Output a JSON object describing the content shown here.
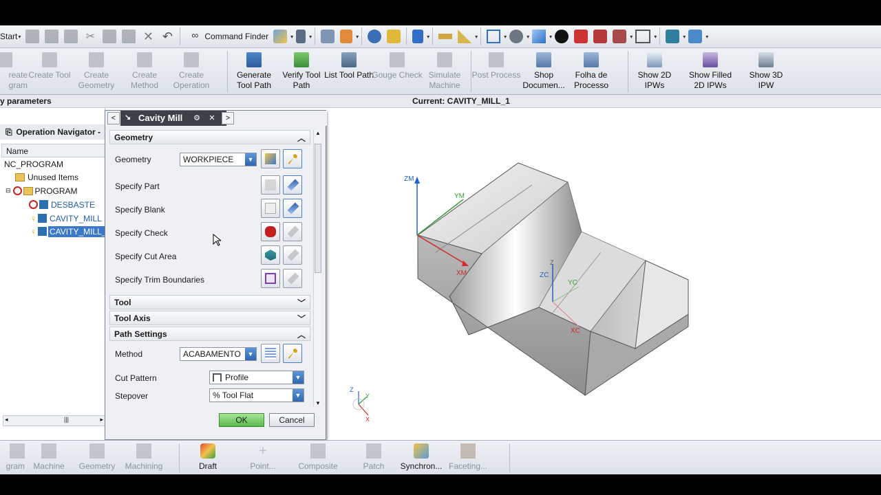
{
  "quick_access": {
    "start_label": "Start",
    "command_finder_label": "Command Finder"
  },
  "ribbon": {
    "buttons": [
      {
        "label": "Create Program",
        "display": "reate\ngram",
        "enabled": false,
        "icon": "program-icon"
      },
      {
        "label": "Create Tool",
        "enabled": false,
        "icon": "tool-icon"
      },
      {
        "label": "Create Geometry",
        "enabled": false,
        "icon": "geometry-icon"
      },
      {
        "label": "Create Method",
        "enabled": false,
        "icon": "method-icon"
      },
      {
        "label": "Create Operation",
        "enabled": false,
        "icon": "operation-icon"
      },
      {
        "label": "Generate Tool Path",
        "enabled": true,
        "icon": "generate-toolpath-icon"
      },
      {
        "label": "Verify Tool Path",
        "enabled": true,
        "icon": "verify-toolpath-icon"
      },
      {
        "label": "List Tool Path",
        "enabled": true,
        "icon": "list-toolpath-icon"
      },
      {
        "label": "Gouge Check",
        "enabled": false,
        "icon": "gouge-check-icon"
      },
      {
        "label": "Simulate Machine",
        "enabled": false,
        "icon": "simulate-machine-icon"
      },
      {
        "label": "Post Process",
        "enabled": false,
        "icon": "post-process-icon"
      },
      {
        "label": "Shop Documen...",
        "enabled": true,
        "icon": "shop-documentation-icon"
      },
      {
        "label": "Folha de Processo",
        "enabled": true,
        "icon": "folha-processo-icon"
      },
      {
        "label": "Show 2D IPWs",
        "enabled": true,
        "icon": "show-2d-ipw-icon"
      },
      {
        "label": "Show Filled 2D IPWs",
        "enabled": true,
        "icon": "show-filled-2d-ipw-icon"
      },
      {
        "label": "Show 3D IPW",
        "enabled": true,
        "icon": "show-3d-ipw-icon"
      }
    ]
  },
  "status": {
    "left_text": "y parameters",
    "current_text": "Current: CAVITY_MILL_1"
  },
  "navigator": {
    "title": "Operation Navigator -",
    "column_name": "Name",
    "items": [
      {
        "label": "NC_PROGRAM"
      },
      {
        "label": "Unused Items"
      },
      {
        "label": "PROGRAM"
      },
      {
        "label": "DESBASTE"
      },
      {
        "label": "CAVITY_MILL"
      },
      {
        "label": "CAVITY_MILL_"
      }
    ]
  },
  "dialog": {
    "title": "Cavity Mill",
    "groups": {
      "geometry": "Geometry",
      "tool": "Tool",
      "tool_axis": "Tool Axis",
      "path_settings": "Path Settings"
    },
    "fields": {
      "geometry_label": "Geometry",
      "geometry_value": "WORKPIECE",
      "specify_part": "Specify Part",
      "specify_blank": "Specify Blank",
      "specify_check": "Specify Check",
      "specify_cut_area": "Specify Cut Area",
      "specify_trim": "Specify Trim Boundaries",
      "method_label": "Method",
      "method_value": "ACABAMENTO",
      "cut_pattern_label": "Cut Pattern",
      "cut_pattern_value": "Profile",
      "stepover_label": "Stepover",
      "stepover_value": "% Tool Flat"
    },
    "ok_label": "OK",
    "cancel_label": "Cancel"
  },
  "viewport": {
    "axis_zm": "ZM",
    "axis_ym": "YM",
    "axis_xm": "XM",
    "axis_zc": "ZC",
    "axis_yc": "YC",
    "axis_xc": "XC",
    "triad_z": "Z",
    "triad_x": "X",
    "triad_y": "Y"
  },
  "bottom_toolbar": {
    "buttons": [
      {
        "label": "gram",
        "enabled": false,
        "icon": "program-icon"
      },
      {
        "label": "Machine",
        "enabled": false,
        "icon": "machine-icon"
      },
      {
        "label": "Geometry",
        "enabled": false,
        "icon": "geometry-icon"
      },
      {
        "label": "Machining",
        "enabled": false,
        "icon": "machining-icon"
      },
      {
        "label": "Draft",
        "enabled": true,
        "icon": "draft-icon"
      },
      {
        "label": "Point...",
        "enabled": false,
        "icon": "point-icon"
      },
      {
        "label": "Composite",
        "enabled": false,
        "icon": "composite-icon"
      },
      {
        "label": "Patch",
        "enabled": false,
        "icon": "patch-icon"
      },
      {
        "label": "Synchron...",
        "enabled": true,
        "icon": "synchronize-icon"
      },
      {
        "label": "Faceting...",
        "enabled": false,
        "icon": "faceting-icon"
      }
    ]
  },
  "colors": {
    "title_bar": "#3d4147",
    "selection": "#3a78c9",
    "link_text": "#1e5ea8",
    "ok_button": "#7bd06a"
  }
}
